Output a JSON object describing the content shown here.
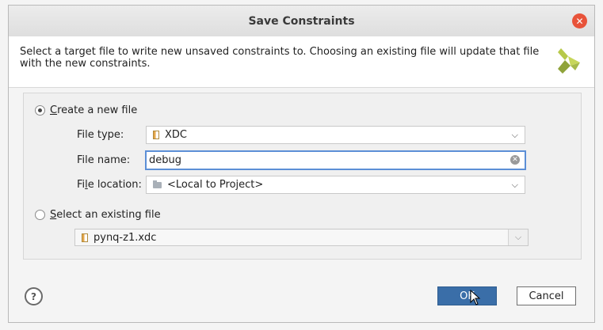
{
  "window": {
    "title": "Save Constraints",
    "close_icon": "close-icon"
  },
  "banner": {
    "text": "Select a target file to write new unsaved constraints to. Choosing an existing file will update that file with the new constraints.",
    "logo_icon": "xilinx-logo-icon"
  },
  "create_new": {
    "label_underlined": "C",
    "label_rest": "reate a new file",
    "selected": true,
    "file_type": {
      "label": "File type:",
      "value": "XDC",
      "icon": "xdc-file-icon"
    },
    "file_name": {
      "label": "File name:",
      "value": "debug"
    },
    "file_location": {
      "label_pre": "Fi",
      "label_underlined": "l",
      "label_post": "e location:",
      "value": "<Local to Project>",
      "icon": "folder-icon"
    }
  },
  "select_existing": {
    "label_underlined": "S",
    "label_rest": "elect an existing file",
    "selected": false,
    "value": "pynq-z1.xdc",
    "icon": "xdc-file-icon"
  },
  "buttons": {
    "help": "?",
    "ok": "OK",
    "cancel": "Cancel"
  },
  "colors": {
    "accent": "#3a6ea8",
    "close": "#e8533a",
    "focus": "#5c8fd6"
  }
}
